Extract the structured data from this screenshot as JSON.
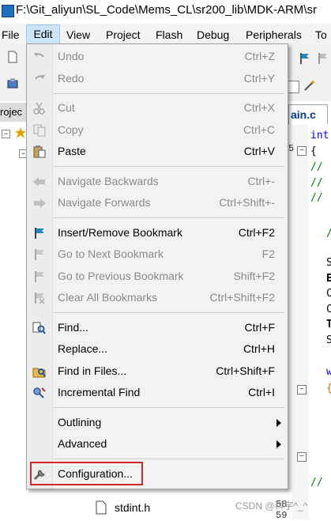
{
  "window": {
    "title": "F:\\Git_aliyun\\SL_Code\\Mems_CL\\sr200_lib\\MDK-ARM\\sr"
  },
  "menubar": {
    "items": [
      "File",
      "Edit",
      "View",
      "Project",
      "Flash",
      "Debug",
      "Peripherals",
      "To"
    ]
  },
  "project_panel": {
    "tab_label": "rojec"
  },
  "editor": {
    "tab_label": "ain.c",
    "code_lines": [
      "int",
      "{",
      "//",
      "//",
      "//",
      "/",
      "S",
      "E",
      "C",
      "C",
      "T",
      "S",
      "w",
      "{",
      "//"
    ],
    "line_numbers": [
      "5",
      "58",
      "59"
    ]
  },
  "edit_menu": {
    "items": [
      {
        "label": "Undo",
        "shortcut": "Ctrl+Z",
        "enabled": false,
        "icon": "undo-icon"
      },
      {
        "label": "Redo",
        "shortcut": "Ctrl+Y",
        "enabled": false,
        "icon": "redo-icon"
      },
      {
        "label": "Cut",
        "shortcut": "Ctrl+X",
        "enabled": false,
        "icon": "cut-icon"
      },
      {
        "label": "Copy",
        "shortcut": "Ctrl+C",
        "enabled": false,
        "icon": "copy-icon"
      },
      {
        "label": "Paste",
        "shortcut": "Ctrl+V",
        "enabled": true,
        "icon": "paste-icon"
      },
      {
        "label": "Navigate Backwards",
        "shortcut": "Ctrl+-",
        "enabled": false,
        "icon": "arrow-left-icon"
      },
      {
        "label": "Navigate Forwards",
        "shortcut": "Ctrl+Shift+-",
        "enabled": false,
        "icon": "arrow-right-icon"
      },
      {
        "label": "Insert/Remove Bookmark",
        "shortcut": "Ctrl+F2",
        "enabled": true,
        "icon": "bookmark-flag-icon"
      },
      {
        "label": "Go to Next Bookmark",
        "shortcut": "F2",
        "enabled": false,
        "icon": "next-bookmark-icon"
      },
      {
        "label": "Go to Previous Bookmark",
        "shortcut": "Shift+F2",
        "enabled": false,
        "icon": "previous-bookmark-icon"
      },
      {
        "label": "Clear All Bookmarks",
        "shortcut": "Ctrl+Shift+F2",
        "enabled": false,
        "icon": "clear-bookmarks-icon"
      },
      {
        "label": "Find...",
        "shortcut": "Ctrl+F",
        "enabled": true,
        "icon": "find-icon"
      },
      {
        "label": "Replace...",
        "shortcut": "Ctrl+H",
        "enabled": true,
        "icon": ""
      },
      {
        "label": "Find in Files...",
        "shortcut": "Ctrl+Shift+F",
        "enabled": true,
        "icon": "find-in-files-icon"
      },
      {
        "label": "Incremental Find",
        "shortcut": "Ctrl+I",
        "enabled": true,
        "icon": "incremental-find-icon"
      },
      {
        "label": "Outlining",
        "shortcut": "",
        "enabled": true,
        "submenu": true
      },
      {
        "label": "Advanced",
        "shortcut": "",
        "enabled": true,
        "submenu": true
      },
      {
        "label": "Configuration...",
        "shortcut": "",
        "enabled": true,
        "icon": "wrench-icon",
        "highlighted": true
      }
    ]
  },
  "tree": {
    "visible_files": [
      "stdint.h"
    ]
  },
  "watermark": {
    "text": "CSDN @科宇^_^"
  },
  "colors": {
    "menu_bg": "#f2f2f2",
    "disabled_text": "#8a8a8a",
    "highlight_border": "#d0272e",
    "menubar_selected": "#cce4f7"
  }
}
